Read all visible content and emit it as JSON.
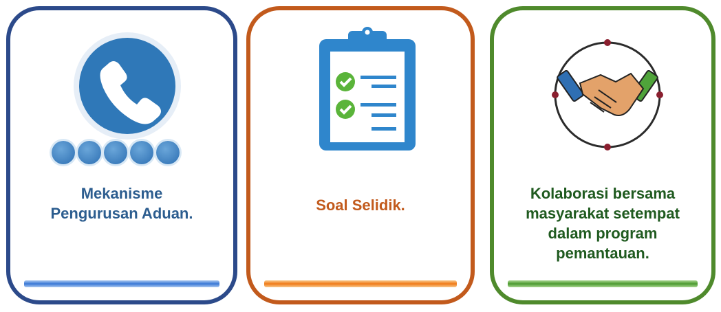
{
  "cards": [
    {
      "label_lines": [
        "Mekanisme",
        "Pengurusan Aduan."
      ],
      "accent": "#2c4a8a",
      "icon": "phone-icon"
    },
    {
      "label_lines": [
        "Soal Selidik."
      ],
      "accent": "#c25a1c",
      "icon": "clipboard-checklist-icon"
    },
    {
      "label_lines": [
        "Kolaborasi bersama",
        "masyarakat setempat",
        "dalam program",
        "pemantauan."
      ],
      "accent": "#4f8a2c",
      "icon": "handshake-icon"
    }
  ],
  "colors": {
    "phone_blue": "#2f78b8",
    "clipboard_blue": "#2f86cc",
    "check_green": "#5ab43a",
    "bar_blue": "#3a78d6",
    "bar_orange": "#f07a18",
    "bar_green": "#4c9a30"
  }
}
